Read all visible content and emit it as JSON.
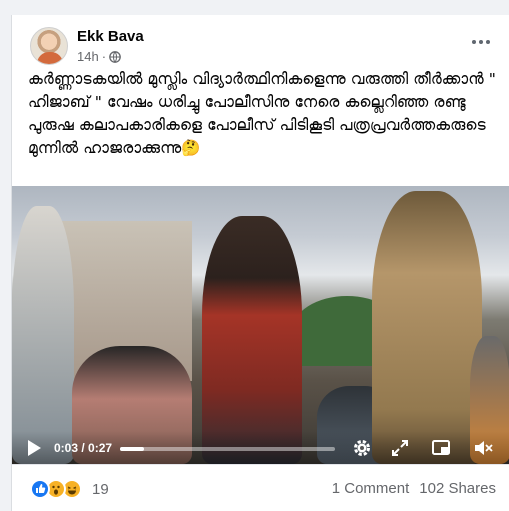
{
  "post": {
    "author": "Ekk Bava",
    "time": "14h",
    "audience_icon": "globe-icon",
    "text": "കർണ്ണാടകയിൽ മുസ്ലിം വിദ്യാർത്ഥിനികളെന്നു വരുത്തി തീർക്കാൻ \" ഹിജാബ് \" വേഷം ധരിച്ചു പോലീസിനു നേരെ കല്ലെറിഞ്ഞ രണ്ടു പുരുഷ കലാപകാരികളെ പോലീസ് പിടികൂടി പത്രപ്രവർത്തകരുടെ മുന്നിൽ ഹാജരാക്കുന്നു🤔"
  },
  "video": {
    "time_display": "0:03 / 0:27",
    "progress": 0.11,
    "controls": [
      "play-icon",
      "settings-icon",
      "expand-icon",
      "pip-icon",
      "volume-icon"
    ]
  },
  "engagement": {
    "reaction_icons": [
      "like-icon",
      "wow-icon",
      "haha-icon"
    ],
    "reaction_count": "19",
    "comments": "1 Comment",
    "shares": "102 Shares"
  },
  "colors": {
    "facebook_blue": "#1877f2",
    "secondary_text": "#65676b",
    "reaction_yellow": "#f7b125"
  }
}
